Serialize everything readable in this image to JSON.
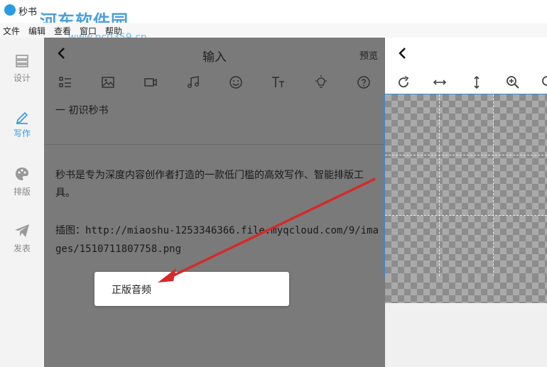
{
  "window": {
    "title": "秒书"
  },
  "watermark": {
    "text": "河东软件园",
    "url": "www.pc0359.cn"
  },
  "menu": [
    "文件",
    "编辑",
    "查看",
    "窗口",
    "帮助"
  ],
  "nav": [
    {
      "label": "设计",
      "icon": "layout-icon"
    },
    {
      "label": "写作",
      "icon": "pen-icon"
    },
    {
      "label": "排版",
      "icon": "palette-icon"
    },
    {
      "label": "发表",
      "icon": "send-icon"
    }
  ],
  "panel": {
    "title": "输入",
    "preview": "预览"
  },
  "toolbar_icons": [
    "list-icon",
    "image-icon",
    "video-icon",
    "music-icon",
    "emoji-icon",
    "text-size-icon",
    "bulb-icon",
    "help-icon"
  ],
  "editor": {
    "heading": "一  初识秒书",
    "para1": "秒书是专为深度内容创作者打造的一款低门槛的高效写作、智能排版工具。",
    "para2": "插图：http://miaoshu-1253346366.file.myqcloud.com/9/images/1510711807758.png"
  },
  "popup": {
    "item": "正版音频"
  },
  "right_toolbar_icons": [
    "rotate-icon",
    "flip-horizontal-icon",
    "flip-vertical-icon",
    "zoom-in-icon"
  ],
  "colors": {
    "accent": "#2a9be0",
    "annotation_arrow": "#d42a2a"
  }
}
